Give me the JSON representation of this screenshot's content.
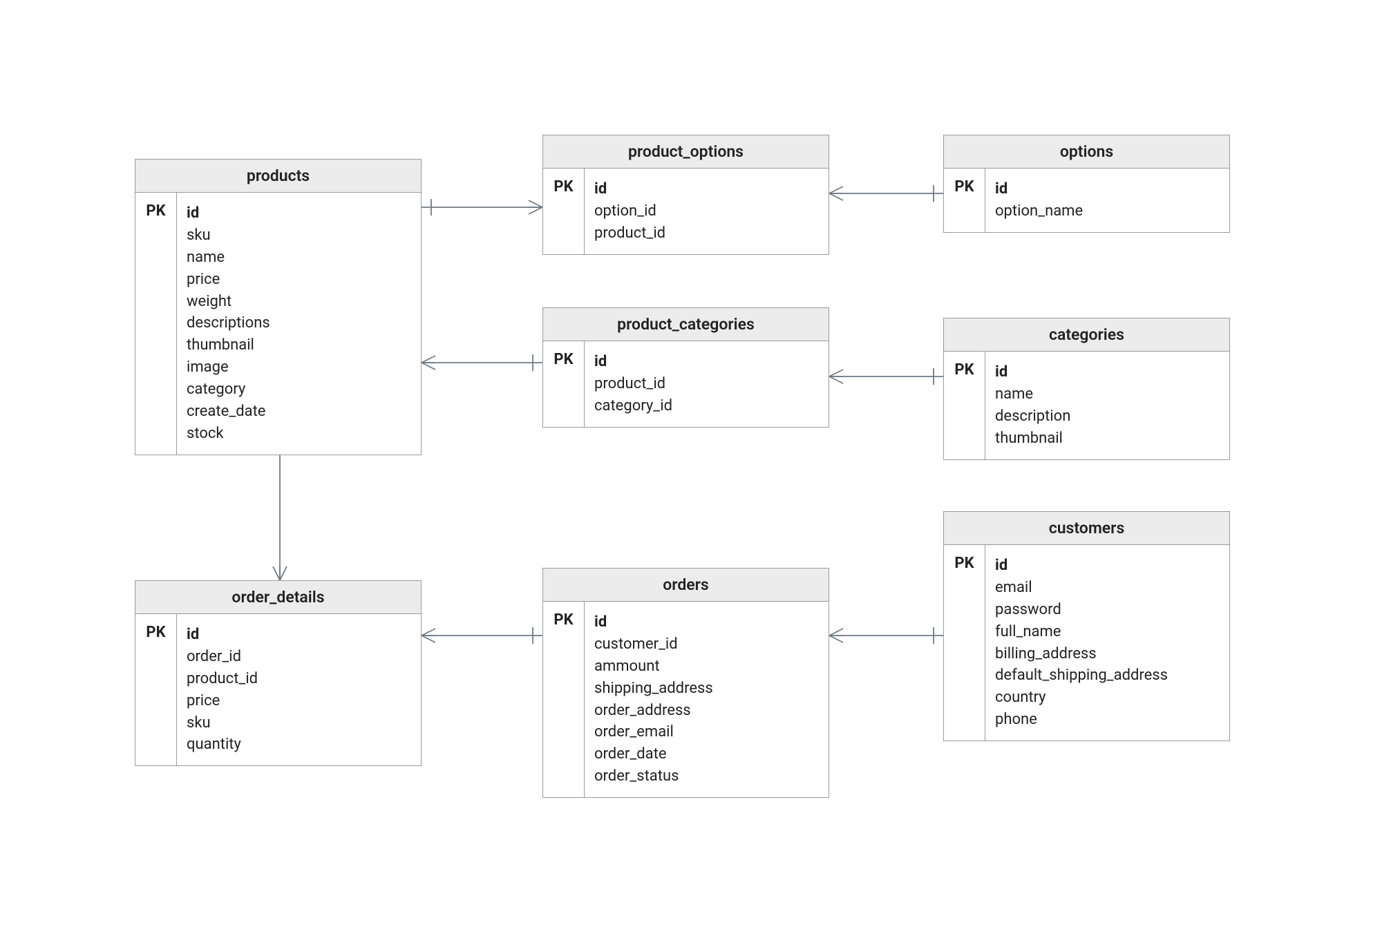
{
  "pk_label": "PK",
  "entities": {
    "products": {
      "title": "products",
      "pk": "id",
      "fields": [
        "sku",
        "name",
        "price",
        "weight",
        "descriptions",
        "thumbnail",
        "image",
        "category",
        "create_date",
        "stock"
      ]
    },
    "product_options": {
      "title": "product_options",
      "pk": "id",
      "fields": [
        "option_id",
        "product_id"
      ]
    },
    "options": {
      "title": "options",
      "pk": "id",
      "fields": [
        "option_name"
      ]
    },
    "product_categories": {
      "title": "product_categories",
      "pk": "id",
      "fields": [
        "product_id",
        "category_id"
      ]
    },
    "categories": {
      "title": "categories",
      "pk": "id",
      "fields": [
        "name",
        "description",
        "thumbnail"
      ]
    },
    "order_details": {
      "title": "order_details",
      "pk": "id",
      "fields": [
        "order_id",
        "product_id",
        "price",
        "sku",
        "quantity"
      ]
    },
    "orders": {
      "title": "orders",
      "pk": "id",
      "fields": [
        "customer_id",
        "ammount",
        "shipping_address",
        "order_address",
        "order_email",
        "order_date",
        "order_status"
      ]
    },
    "customers": {
      "title": "customers",
      "pk": "id",
      "fields": [
        "email",
        "password",
        "full_name",
        "billing_address",
        "default_shipping_address",
        "country",
        "phone"
      ]
    }
  }
}
